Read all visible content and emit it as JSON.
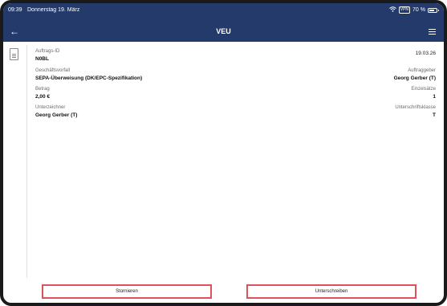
{
  "status": {
    "time": "09:39",
    "date": "Donnerstag 19. März",
    "vpn": "VPN",
    "battery": "70 %"
  },
  "nav": {
    "title": "VEU",
    "back_icon": "arrow-left-icon",
    "menu_icon": "list-menu-icon"
  },
  "details": {
    "auftrags_id": {
      "label": "Auftrags-ID",
      "value": "N0BL"
    },
    "datum": {
      "value": "19.03.26"
    },
    "geschaeftsvorfall": {
      "label": "Geschäftsvorfall",
      "value": "SEPA-Überweisung (DK/EPC-Spezifikation)"
    },
    "auftraggeber": {
      "label": "Auftraggeber",
      "value": "Georg Gerber (T)"
    },
    "betrag": {
      "label": "Betrag",
      "value": "2,00 €"
    },
    "einzelsaetze": {
      "label": "Einzelsätze",
      "value": "1"
    },
    "unterzeichner": {
      "label": "Unterzeichner",
      "value": "Georg Gerber (T)"
    },
    "unterschriftsklasse": {
      "label": "Unterschriftsklasse",
      "value": "T"
    }
  },
  "actions": {
    "cancel": "Stornieren",
    "sign": "Unterschreiben"
  },
  "colors": {
    "header": "#233a6b",
    "button_border": "#e0505a"
  }
}
